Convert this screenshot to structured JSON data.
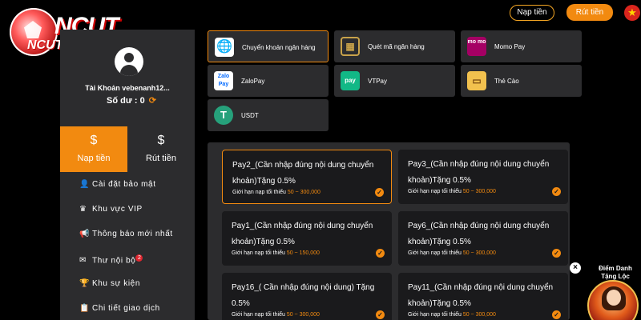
{
  "brand": {
    "logo_text_main": "NCUT",
    "logo_text_sub": "NCUT.NET"
  },
  "header": {
    "deposit_button": "Nạp tiền",
    "withdraw_button": "Rút tiền",
    "language_flag": "vietnam-flag-icon"
  },
  "profile": {
    "account_name": "Tài Khoản vebenanh12...",
    "balance_label": "Số dư :",
    "balance_value": "0"
  },
  "tabs": [
    {
      "label": "Nạp tiền",
      "icon": "money-bag-icon",
      "active": true
    },
    {
      "label": "Rút tiền",
      "icon": "hand-money-icon",
      "active": false
    }
  ],
  "menu": [
    {
      "label": "Cài đặt bảo mật",
      "icon": "user-lock-icon"
    },
    {
      "label": "Khu vực VIP",
      "icon": "crown-icon"
    },
    {
      "label": "Thông báo mới nhất",
      "icon": "megaphone-icon"
    },
    {
      "label": "Thư nội bộ",
      "icon": "mail-icon",
      "badge": "2"
    },
    {
      "label": "Khu sự kiện",
      "icon": "trophy-icon"
    },
    {
      "label": "Chi tiết giao dịch",
      "icon": "clipboard-icon"
    }
  ],
  "payment_methods": [
    {
      "label": "Chuyển khoản ngân hàng",
      "icon": "globe-icon",
      "active": true
    },
    {
      "label": "Quét mã ngân hàng",
      "icon": "qr-code-icon",
      "active": false
    },
    {
      "label": "Momo Pay",
      "icon": "momo-icon",
      "icon_text": "mo mo",
      "active": false
    },
    {
      "label": "ZaloPay",
      "icon": "zalopay-icon",
      "icon_text": "Zalo Pay",
      "active": false
    },
    {
      "label": "VTPay",
      "icon": "vtpay-icon",
      "icon_text": "pay",
      "active": false
    },
    {
      "label": "Thẻ Cào",
      "icon": "card-icon",
      "active": false
    },
    {
      "label": "USDT",
      "icon": "tether-icon",
      "icon_text": "T",
      "active": false
    }
  ],
  "gateways": [
    {
      "title": "Pay2_(Cần nhập đúng nội dung chuyển khoản)Tặng 0.5%",
      "limit_label": "Giới hạn nạp tối thiểu",
      "limit_range": "50 ~ 300,000",
      "active": true
    },
    {
      "title": "Pay3_(Cần nhập đúng nội dung chuyển khoản)Tặng 0.5%",
      "limit_label": "Giới hạn nạp tối thiểu",
      "limit_range": "50 ~ 300,000",
      "active": false
    },
    {
      "title": "Pay1_(Cần nhập đúng nội dung chuyển khoản)Tặng 0.5%",
      "limit_label": "Giới hạn nạp tối thiểu",
      "limit_range": "50 ~ 150,000",
      "active": false
    },
    {
      "title": "Pay6_(Cần nhập đúng nội dung chuyển khoản)Tặng 0.5%",
      "limit_label": "Giới hạn nạp tối thiểu",
      "limit_range": "50 ~ 300,000",
      "active": false
    },
    {
      "title": "Pay16_( Cần nhập đúng nội dung) Tặng 0.5%",
      "limit_label": "Giới hạn nạp tối thiểu",
      "limit_range": "50 ~ 300,000",
      "active": false
    },
    {
      "title": "Pay11_(Cần nhập đúng nội dung chuyển khoản)Tặng 0.5%",
      "limit_label": "Giới hạn nạp tối thiểu",
      "limit_range": "50 ~ 300,000",
      "active": false
    }
  ],
  "promo": {
    "line1": "Điểm Danh",
    "line2": "Tặng Lộc"
  },
  "colors": {
    "accent": "#f28a10",
    "panel": "#2c2c2e",
    "card": "#1a1a1c",
    "background": "#000000"
  }
}
